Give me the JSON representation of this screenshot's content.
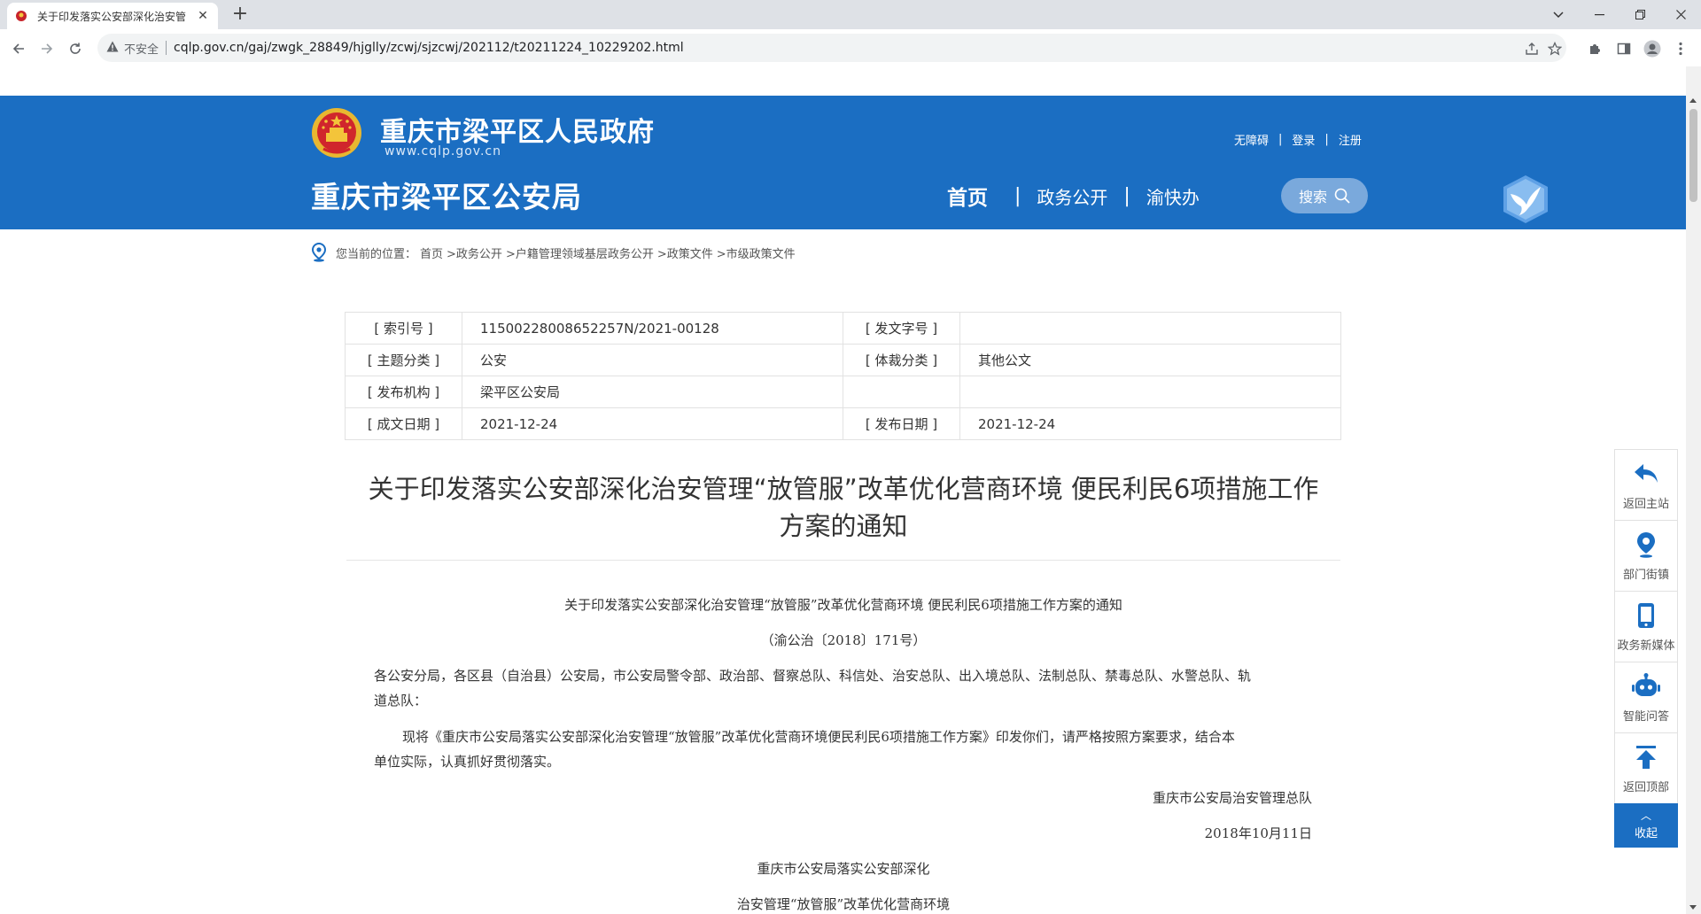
{
  "browser": {
    "tab_title": "关于印发落实公安部深化治安管",
    "tab_close": "✕",
    "new_tab": "+",
    "security_label": "不安全",
    "url": "cqlp.gov.cn/gaj/zwgk_28849/hjglly/zcwj/sjzcwj/202112/t20211224_10229202.html"
  },
  "header": {
    "gov_name": "重庆市梁平区人民政府",
    "gov_url": "www.cqlp.gov.cn",
    "bureau_name": "重庆市梁平区公安局",
    "top_links": [
      "无障碍",
      "登录",
      "注册"
    ],
    "link_separator": "|",
    "nav": [
      "首页",
      "政务公开",
      "渝快办"
    ],
    "search_label": "搜索",
    "brand_color": "#1b6ec2"
  },
  "breadcrumb": {
    "prefix": "您当前的位置：",
    "items": [
      "首页",
      ">政务公开",
      ">户籍管理领域基层政务公开",
      ">政策文件",
      ">市级政策文件"
    ]
  },
  "meta": {
    "rows": [
      {
        "label1": "[ 索引号 ]",
        "value1": "11500228008652257N/2021-00128",
        "label2": "[ 发文字号 ]",
        "value2": ""
      },
      {
        "label1": "[ 主题分类 ]",
        "value1": "公安",
        "label2": "[ 体裁分类 ]",
        "value2": "其他公文"
      },
      {
        "label1": "[ 发布机构 ]",
        "value1": "梁平区公安局",
        "label2": "",
        "value2": ""
      },
      {
        "label1": "[ 成文日期 ]",
        "value1": "2021-12-24",
        "label2": "[ 发布日期 ]",
        "value2": "2021-12-24"
      }
    ]
  },
  "article": {
    "title_line1": "关于印发落实公安部深化治安管理“放管服”改革优化营商环境 便民利民6项措施工作",
    "title_line2": "方案的通知",
    "subtitle": "关于印发落实公安部深化治安管理“放管服”改革优化营商环境  便民利民6项措施工作方案的通知",
    "doc_number": "（渝公治〔2018〕171号）",
    "addressees_line1": "各公安分局，各区县（自治县）公安局，市公安局警令部、政治部、督察总队、科信处、治安总队、出入境总队、法制总队、禁毒总队、水警总队、轨",
    "addressees_line2": "道总队：",
    "body_line1": "现将《重庆市公安局落实公安部深化治安管理“放管服”改革优化营商环境便民利民6项措施工作方案》印发你们，请严格按照方案要求，结合本",
    "body_line2": "单位实际，认真抓好贯彻落实。",
    "signer": "重庆市公安局治安管理总队",
    "date": "2018年10月11日",
    "attachment_title1": "重庆市公安局落实公安部深化",
    "attachment_title2": "治安管理“放管服”改革优化营商环境"
  },
  "float_bar": {
    "items": [
      "返回主站",
      "部门街镇",
      "政务新媒体",
      "智能问答",
      "返回顶部"
    ],
    "collapse_caret": "︿",
    "collapse": "收起"
  }
}
